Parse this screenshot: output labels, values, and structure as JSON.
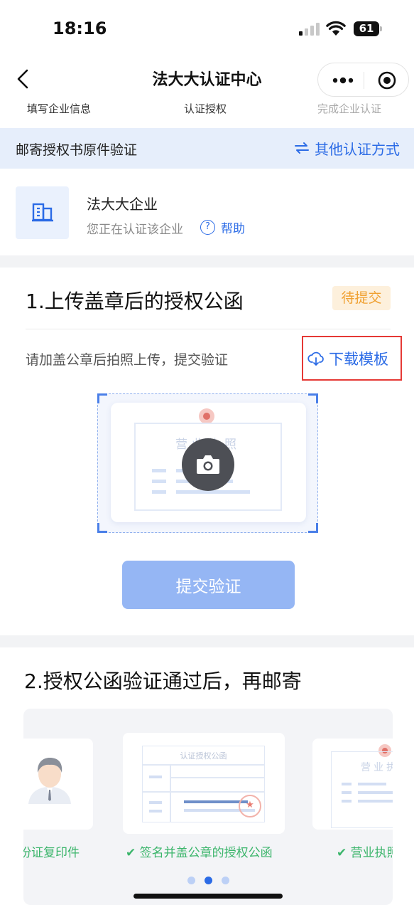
{
  "status_bar": {
    "time": "18:16",
    "battery": "61"
  },
  "nav": {
    "title": "法大大认证中心",
    "steps": [
      "填写企业信息",
      "认证授权",
      "完成企业认证"
    ]
  },
  "info_bar": {
    "title": "邮寄授权书原件验证",
    "switch_label": "其他认证方式"
  },
  "company": {
    "name": "法大大企业",
    "subtitle": "您正在认证该企业",
    "help_label": "帮助"
  },
  "section1": {
    "title": "1.上传盖章后的授权公函",
    "badge": "待提交",
    "hint": "请加盖公章后拍照上传，提交验证",
    "download_label": "下载模板",
    "license_title": "营业执照",
    "submit_label": "提交验证"
  },
  "section2": {
    "title": "2.授权公函验证通过后，再邮寄",
    "slides": [
      {
        "caption": "份证复印件"
      },
      {
        "caption": "✔ 签名并盖公章的授权公函",
        "doc_title": "认证授权公函"
      },
      {
        "caption": "✔ 营业执照",
        "doc_title": "营业执"
      }
    ],
    "active_dot": 1
  },
  "colors": {
    "accent": "#2b6be6",
    "badge_text": "#f0a030",
    "badge_bg": "#fdf0dc",
    "success": "#3bb56b",
    "highlight_box": "#e53935",
    "submit_disabled": "#95b6f4"
  }
}
